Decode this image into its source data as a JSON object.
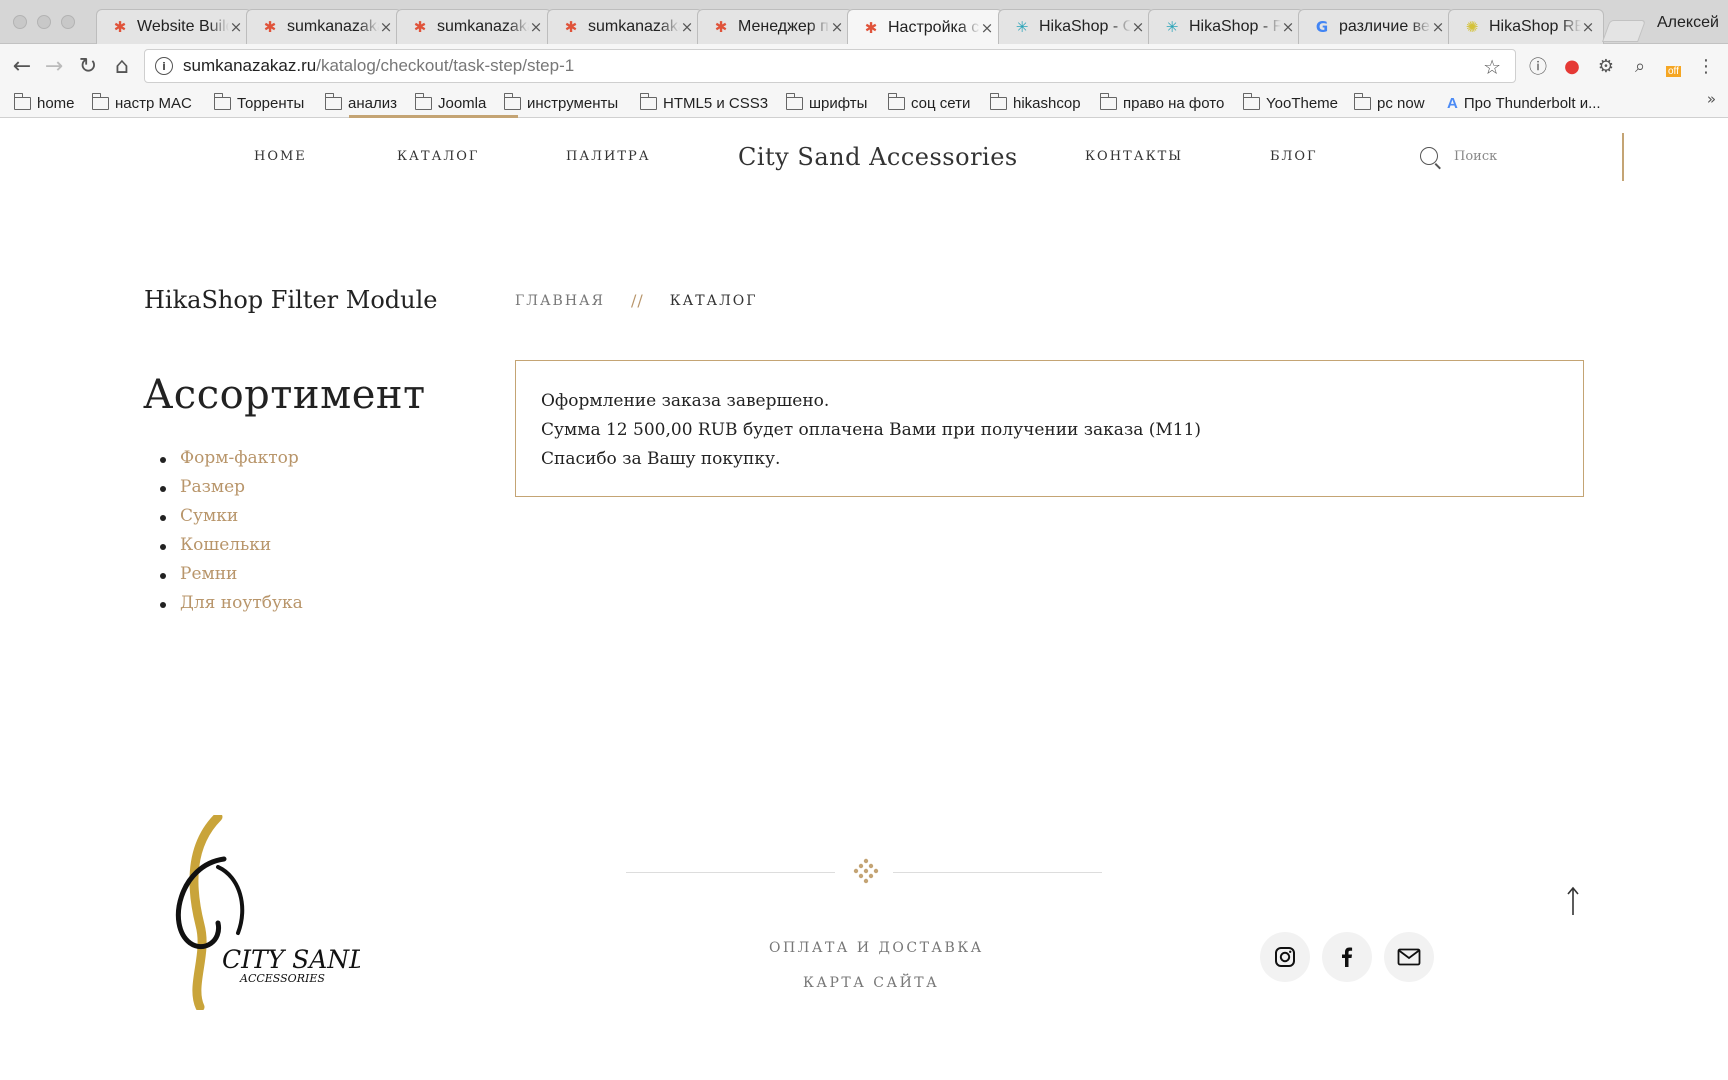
{
  "browser": {
    "tabs": [
      {
        "title": "Website Builder",
        "icon": "joomla-icon"
      },
      {
        "title": "sumkanazakaz",
        "icon": "joomla-icon"
      },
      {
        "title": "sumkanazakaz",
        "icon": "joomla-icon"
      },
      {
        "title": "sumkanazakaz",
        "icon": "joomla-icon"
      },
      {
        "title": "Менеджер п",
        "icon": "joomla-icon"
      },
      {
        "title": "Настройка с",
        "icon": "joomla-icon"
      },
      {
        "title": "HikaShop - C",
        "icon": "hikashop-icon"
      },
      {
        "title": "HikaShop - F",
        "icon": "hikashop-icon"
      },
      {
        "title": "различие ве",
        "icon": "google-icon"
      },
      {
        "title": "HikaShop RE",
        "icon": "hikashop-yellow-icon"
      }
    ],
    "active_tab": 5,
    "profile_name": "Алексей",
    "url_host": "sumkanazakaz.ru",
    "url_path": "/katalog/checkout/task-step/step-1",
    "bookmarks": [
      "home",
      "настр MAC",
      "Торренты",
      "анализ",
      "Joomla",
      "инструменты",
      "HTML5 и CSS3",
      "шрифты",
      "соц сети",
      "hikashcop",
      "право на фото",
      "YooTheme",
      "pc now",
      "Про Thunderbolt и..."
    ],
    "ext_badge": "off"
  },
  "header": {
    "nav": [
      "HOME",
      "КАТАЛОГ",
      "ПАЛИТРА",
      "КОНТАКТЫ",
      "БЛОГ"
    ],
    "site_title": "City Sand Accessories",
    "search_placeholder": "Поиск"
  },
  "sidebar": {
    "module_title": "HikaShop Filter Module",
    "heading": "Ассортимент",
    "categories": [
      "Форм-фактор",
      "Размер",
      "Сумки",
      "Кошельки",
      "Ремни",
      "Для ноутбука"
    ]
  },
  "breadcrumb": {
    "home": "ГЛАВНАЯ",
    "separator": "//",
    "current": "КАТАЛОГ"
  },
  "message": {
    "line1": "Оформление заказа завершено.",
    "line2": "Сумма 12 500,00 RUB будет оплачена Вами при получении заказа (M11)",
    "line3": "Спасибо за Вашу покупку."
  },
  "footer": {
    "logo_text_main": "CITY SAND",
    "logo_text_sub": "ACCESSORIES",
    "links": [
      "ОПЛАТА И ДОСТАВКА",
      "КАРТА САЙТА"
    ],
    "social": [
      "instagram-icon",
      "facebook-icon",
      "mail-icon"
    ]
  },
  "colors": {
    "accent_gold": "#c4a474",
    "link_gold": "#b8956a",
    "text_dark": "#222222"
  }
}
